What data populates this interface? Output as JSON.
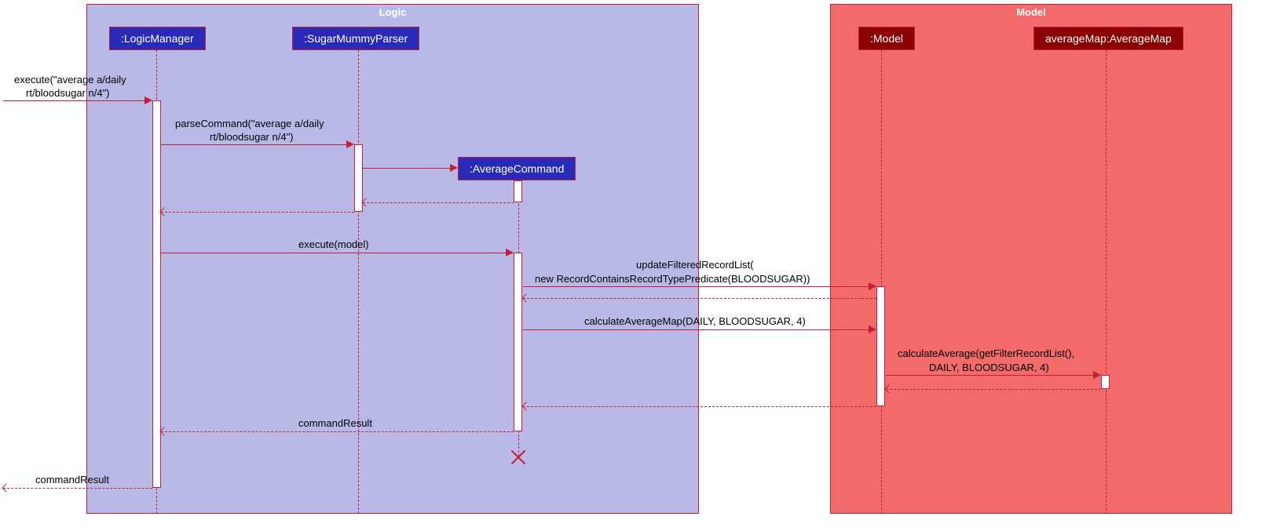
{
  "containers": {
    "logic": {
      "title": "Logic"
    },
    "model": {
      "title": "Model"
    }
  },
  "participants": {
    "logicManager": ":LogicManager",
    "parser": ":SugarMummyParser",
    "avgCmd": ":AverageCommand",
    "model": ":Model",
    "avgMap": "averageMap:AverageMap"
  },
  "messages": {
    "execIn1": "execute(\"average a/daily",
    "execIn2": "rt/bloodsugar n/4\")",
    "parse1": "parseCommand(\"average a/daily",
    "parse2": "rt/bloodsugar n/4\")",
    "execModel": "execute(model)",
    "update1": "updateFilteredRecordList(",
    "update2": "new RecordContainsRecordTypePredicate(BLOODSUGAR))",
    "calcMap": "calculateAverageMap(DAILY, BLOODSUGAR, 4)",
    "calcAvg1": "calculateAverage(getFilterRecordList(),",
    "calcAvg2": "DAILY, BLOODSUGAR, 4)",
    "cmdResult": "commandResult",
    "cmdResultOut": "commandResult"
  },
  "colors": {
    "logicBg": "#b9b9e8",
    "logicBorder": "#c41e3a",
    "modelBg": "#f26a6a",
    "modelBorder": "#c41e3a",
    "blueBox": "#2a2ab8",
    "darkRedBox": "#8b0000",
    "line": "#c41e3a"
  }
}
